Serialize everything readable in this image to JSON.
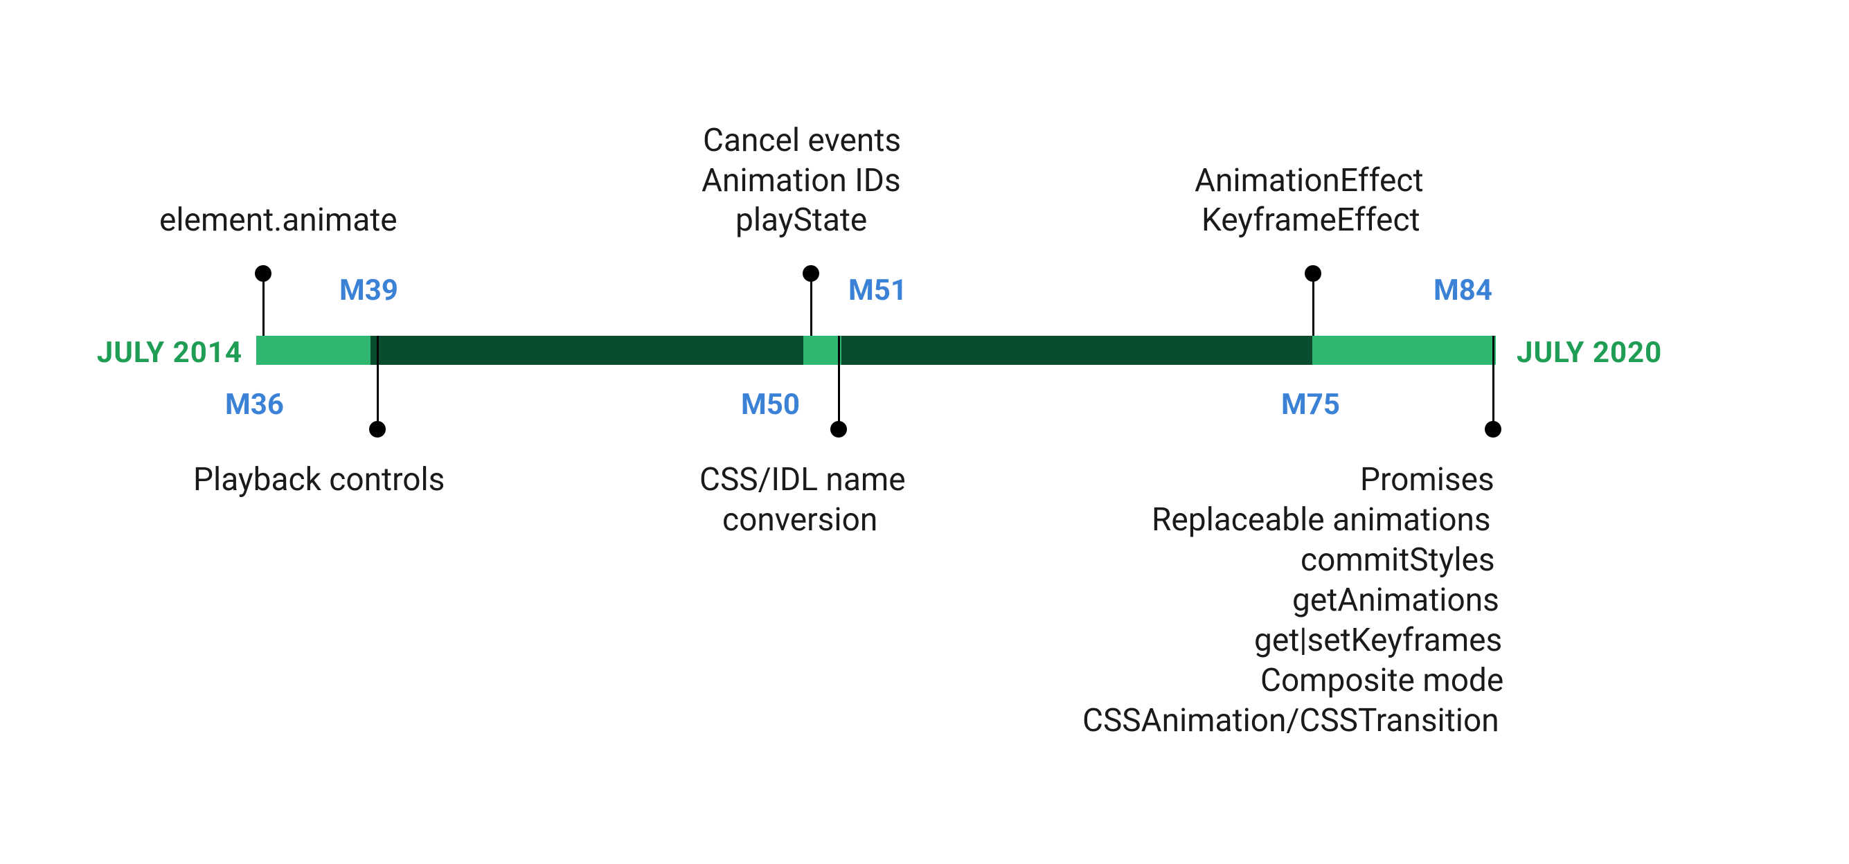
{
  "colors": {
    "bright_green": "#2fb670",
    "dark_green": "#0a4d2e",
    "blue": "#3b82d6",
    "green_text": "#1f9d55"
  },
  "dates": {
    "start": "JULY 2014",
    "end": "JULY 2020"
  },
  "milestones": {
    "m36": "M36",
    "m39": "M39",
    "m50": "M50",
    "m51": "M51",
    "m75": "M75",
    "m84": "M84"
  },
  "features": {
    "m36": [
      "element.animate"
    ],
    "m39": [
      "Playback controls"
    ],
    "m50": [
      "CSS/IDL name",
      "conversion"
    ],
    "m51": [
      "Cancel events",
      "Animation IDs",
      "playState"
    ],
    "m75": [
      "AnimationEffect",
      "KeyframeEffect"
    ],
    "m84": [
      "Promises",
      "Replaceable animations",
      "commitStyles",
      "getAnimations",
      "get|setKeyframes",
      "Composite mode",
      "CSSAnimation/CSSTransition"
    ]
  },
  "chart_data": {
    "type": "timeline",
    "title": "",
    "start_label": "JULY 2014",
    "end_label": "JULY 2020",
    "axis_range_months": [
      0,
      72
    ],
    "bar_segments": [
      {
        "from": 0,
        "to": 6,
        "color": "bright_green"
      },
      {
        "from": 6,
        "to": 28,
        "color": "dark_green"
      },
      {
        "from": 28,
        "to": 30,
        "color": "bright_green"
      },
      {
        "from": 30,
        "to": 60,
        "color": "dark_green"
      },
      {
        "from": 60,
        "to": 72,
        "color": "bright_green"
      }
    ],
    "events": [
      {
        "milestone": "M36",
        "approx_month": 0,
        "side": "top",
        "features": [
          "element.animate"
        ]
      },
      {
        "milestone": "M39",
        "approx_month": 6,
        "side": "bottom",
        "features": [
          "Playback controls"
        ]
      },
      {
        "milestone": "M50",
        "approx_month": 28,
        "side": "bottom",
        "features": [
          "CSS/IDL name conversion"
        ]
      },
      {
        "milestone": "M51",
        "approx_month": 30,
        "side": "top",
        "features": [
          "Cancel events",
          "Animation IDs",
          "playState"
        ]
      },
      {
        "milestone": "M75",
        "approx_month": 60,
        "side": "top",
        "features": [
          "AnimationEffect",
          "KeyframeEffect"
        ]
      },
      {
        "milestone": "M84",
        "approx_month": 72,
        "side": "bottom",
        "features": [
          "Promises",
          "Replaceable animations",
          "commitStyles",
          "getAnimations",
          "get|setKeyframes",
          "Composite mode",
          "CSSAnimation/CSSTransition"
        ]
      }
    ]
  }
}
